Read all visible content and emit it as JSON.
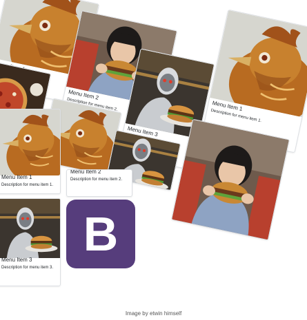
{
  "menu_cards": [
    {
      "title": "Menu Item 1",
      "description": "Description for menu item 1.",
      "image": "chicken-photo"
    },
    {
      "title": "Menu Item 2",
      "description": "Description for menu item 2.",
      "image": "girl-eating-burger-photo"
    },
    {
      "title": "Menu Item 3",
      "description": "Description for menu item 3.",
      "image": "robot-burger-photo"
    }
  ],
  "logo": {
    "letter": "B",
    "color": "#563d7c"
  },
  "credit": "Image by etwin himself"
}
